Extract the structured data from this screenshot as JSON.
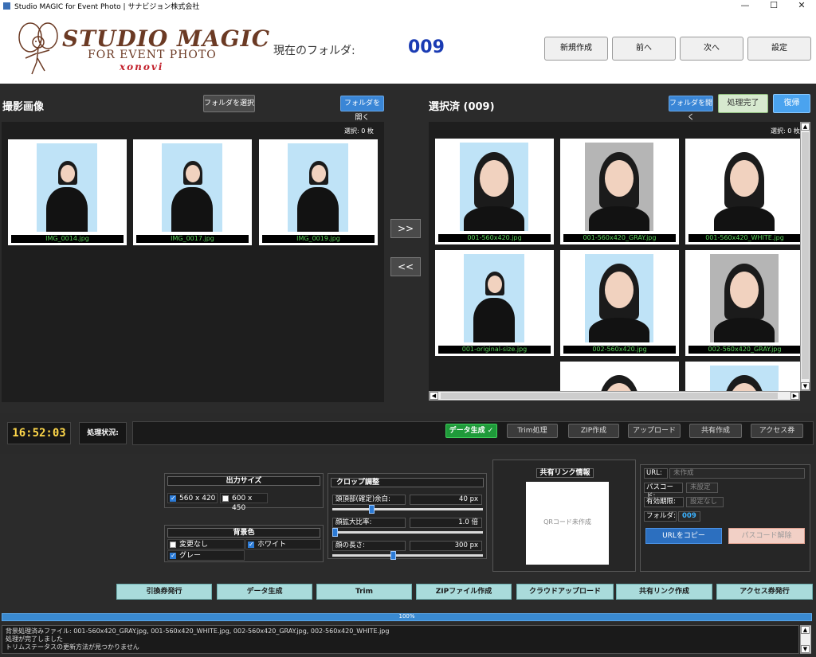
{
  "window": {
    "title": "Studio MAGIC for Event Photo | サナビジョン株式会社",
    "min": "—",
    "max": "☐",
    "close": "✕"
  },
  "header": {
    "logo_main": "STUDIO MAGIC",
    "logo_sub": "FOR EVENT PHOTO",
    "logo_brand": "xonovi",
    "folder_label": "現在のフォルダ:",
    "folder_value": "009",
    "buttons": [
      "新規作成",
      "前へ",
      "次へ",
      "設定"
    ]
  },
  "left_panel": {
    "title": "撮影画像",
    "select_folder_btn": "フォルダを選択",
    "open_folder_btn": "フォルダを開く",
    "count_text": "選択: 0 枚",
    "images": [
      "IMG_0014.jpg",
      "IMG_0017.jpg",
      "IMG_0019.jpg"
    ]
  },
  "transfer": {
    "forward": ">>",
    "back": "<<"
  },
  "right_panel": {
    "title": "選択済 (009)",
    "open_folder_btn": "フォルダを開く",
    "done_btn": "処理完了",
    "restore_btn": "復帰",
    "count_text": "選択: 0 枚",
    "images": [
      {
        "name": "001-560x420.jpg",
        "bg": "#bfe3f7"
      },
      {
        "name": "001-560x420_GRAY.jpg",
        "bg": "#b5b5b5"
      },
      {
        "name": "001-560x420_WHITE.jpg",
        "bg": "#ffffff"
      },
      {
        "name": "001-original-size.jpg",
        "bg": "#bfe3f7"
      },
      {
        "name": "002-560x420.jpg",
        "bg": "#bfe3f7"
      },
      {
        "name": "002-560x420_GRAY.jpg",
        "bg": "#b5b5b5"
      }
    ]
  },
  "status": {
    "clock": "16:52:03",
    "label": "処理状況:",
    "steps": [
      "データ生成 ✓",
      "Trim処理",
      "ZIP作成",
      "アップロード",
      "共有作成",
      "アクセス券"
    ]
  },
  "output_size": {
    "title": "出力サイズ",
    "options": [
      {
        "label": "560 x 420",
        "checked": true
      },
      {
        "label": "600 x 450",
        "checked": false
      }
    ]
  },
  "background": {
    "title": "背景色",
    "options": [
      {
        "label": "変更なし",
        "checked": false
      },
      {
        "label": "ホワイト",
        "checked": true
      },
      {
        "label": "グレー",
        "checked": true
      }
    ]
  },
  "crop": {
    "title": "クロップ調整",
    "rows": [
      {
        "label": "頭頂部(確定)余白:",
        "value": "40 px",
        "level": 0.25
      },
      {
        "label": "顔拡大比率:",
        "value": "1.0 倍",
        "level": 0.0
      },
      {
        "label": "顔の長さ:",
        "value": "300 px",
        "level": 0.4
      }
    ]
  },
  "share": {
    "title": "共有リンク情報",
    "qr_text": "QRコード未作成",
    "url_label": "URL:",
    "url_value": "未作成",
    "pass_label": "パスコード:",
    "pass_value": "未設定",
    "expiry_label": "有効期限:",
    "expiry_value": "設定なし",
    "folder_label": "フォルダ:",
    "folder_value": "009",
    "copy_btn": "URLをコピー",
    "unlock_btn": "パスコード解除"
  },
  "actions": [
    "引換券発行",
    "データ生成",
    "Trim",
    "ZIPファイル作成",
    "クラウドアップロード",
    "共有リンク作成",
    "アクセス券発行"
  ],
  "progress": {
    "text": "100%",
    "level": 1.0
  },
  "log": [
    "背景処理済みファイル: 001-560x420_GRAY.jpg, 001-560x420_WHITE.jpg, 002-560x420_GRAY.jpg, 002-560x420_WHITE.jpg",
    "処理が完了しました",
    "トリムステータスの更新方法が見つかりません"
  ]
}
